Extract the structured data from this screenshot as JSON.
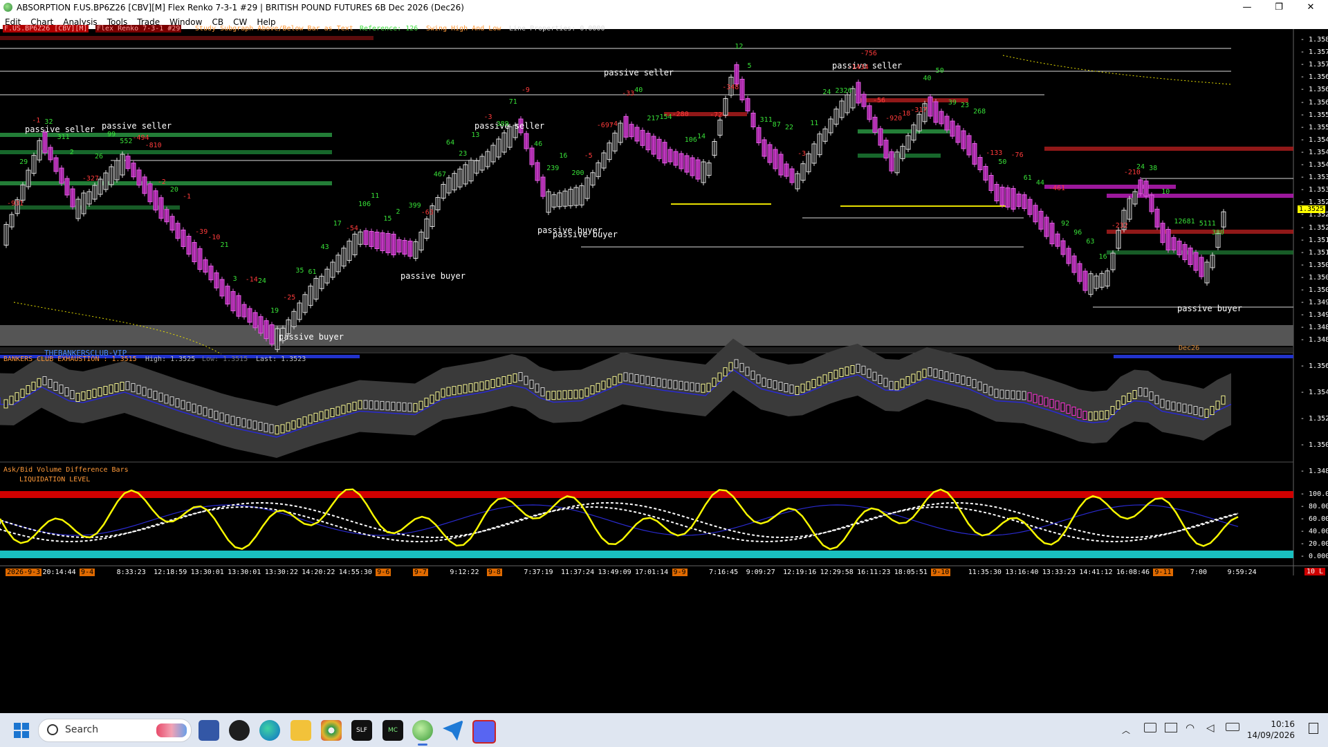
{
  "window": {
    "title": "ABSORPTION  F.US.BP6Z26 [CBV][M]  Flex Renko 7-3-1 #29 | BRITISH POUND FUTURES 6B Dec 2026 (Dec26)",
    "min_glyph": "—",
    "max_glyph": "❐",
    "close_glyph": "✕"
  },
  "menu": [
    "Edit",
    "Chart",
    "Analysis",
    "Tools",
    "Trade",
    "Window",
    "CB",
    "CW",
    "Help"
  ],
  "chart": {
    "header": {
      "symbol": " F.US.BP6Z26 [CBV][M]",
      "bartype": "Flex Renko 7-3-1 #29",
      "study": "Study Subgraph Above/Below Bar as Text",
      "reference": "Reference: 126",
      "swing": "Swing High And Low",
      "lineprops": "Line Properties: 0.0000"
    },
    "annotations": [
      "passive seller",
      "passive seller",
      "passive seller",
      "passive seller",
      "passive seller",
      "passive buyer",
      "passive buyer",
      "passive buyer",
      "passive buyer",
      "passive buyer"
    ],
    "watermark": "THEBANKERSCLUB-VIP",
    "contract_label": "Dec26",
    "current_price": "1.3525",
    "price_axis": [
      "1.3580",
      "1.3576",
      "1.3572",
      "1.3568",
      "1.3564",
      "1.3560",
      "1.3556",
      "1.3552",
      "1.3548",
      "1.3544",
      "1.3540",
      "1.3536",
      "1.3532",
      "1.3528",
      "1.3524",
      "1.3520",
      "1.3516",
      "1.3512",
      "1.3508",
      "1.3504",
      "1.3500",
      "1.3496",
      "1.3492",
      "1.3488",
      "1.3484"
    ],
    "delta_labels": [
      "-931",
      "29",
      "-1",
      "32",
      "311",
      "2",
      "-327",
      "26",
      "99",
      "552",
      "-494",
      "-810",
      "-2",
      "20",
      "-1",
      "-39",
      "-10",
      "21",
      "3",
      "-14",
      "24",
      "19",
      "-25",
      "35",
      "61",
      "43",
      "17",
      "-54",
      "106",
      "11",
      "15",
      "2",
      "399",
      "-63",
      "467",
      "64",
      "23",
      "13",
      "-3",
      "389",
      "71",
      "-9",
      "46",
      "239",
      "16",
      "200",
      "-5",
      "-697",
      "-4",
      "-33",
      "40",
      "217",
      "154",
      "-280",
      "106",
      "14",
      "-72",
      "-348",
      "12",
      "5",
      "311",
      "87",
      "22",
      "-3",
      "11",
      "24",
      "2326",
      "-1434",
      "-756",
      "-56",
      "-920",
      "-18",
      "-317",
      "40",
      "50",
      "39",
      "23",
      "268",
      "-133",
      "50",
      "-76",
      "61",
      "44",
      "-461",
      "92",
      "96",
      "63",
      "16",
      "-232",
      "-210",
      "24",
      "38",
      "10",
      "126",
      "81",
      "5111",
      "300"
    ],
    "indicator_title": "BANKERS CLUB EXHAUSTION : 1.3515",
    "indicator_high": "High: 1.3525",
    "indicator_low": "Low: 1.3515",
    "indicator_last": "Last: 1.3523",
    "mid_axis": [
      "1.3560",
      "1.3540",
      "1.3520",
      "1.3500",
      "1.3480"
    ],
    "osc_title": "Ask/Bid Volume Difference Bars",
    "osc_subtitle": "LIQUIDATION LEVEL",
    "osc_axis": [
      "100.000",
      "80.000",
      "60.000",
      "40.000",
      "20.000",
      "0.0000"
    ],
    "time_axis": [
      "2026-9-3",
      "20:14:44",
      "9-4",
      "8:33:23",
      "12:18:59",
      "13:30:01",
      "13:30:01",
      "13:30:22",
      "14:20:22",
      "14:55:30",
      "9-6",
      "9-7",
      "9:12:22",
      "9-8",
      "7:37:19",
      "11:37:24",
      "13:49:09",
      "17:01:14",
      "9-9",
      "7:16:45",
      "9:09:27",
      "12:19:16",
      "12:29:58",
      "16:11:23",
      "18:05:51",
      "9-10",
      "11:35:30",
      "13:16:40",
      "13:33:23",
      "14:41:12",
      "16:08:46",
      "9-11",
      "7:00",
      "9:59:24"
    ],
    "corner_badge": "10 L"
  },
  "taskbar": {
    "search_placeholder": "Search",
    "clock_time": "10:16",
    "clock_date": "14/09/2026",
    "start_icon": "windows-start-icon",
    "app_icons": [
      "network-app-icon",
      "maps-app-icon",
      "edge-browser-icon",
      "file-explorer-icon",
      "chrome-like-icon",
      "slf-app-icon",
      "mc-markets-icon",
      "sierra-chart-icon",
      "telegram-icon",
      "discord-icon"
    ]
  }
}
